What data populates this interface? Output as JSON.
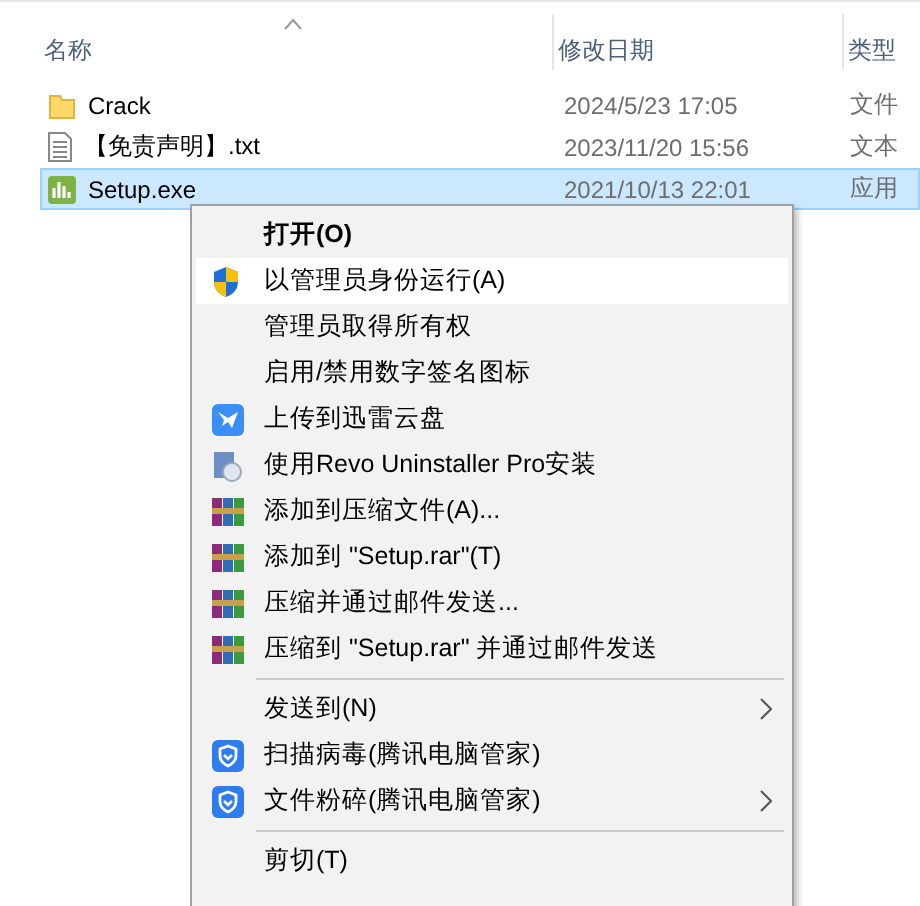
{
  "columns": [
    {
      "label": "名称",
      "sorted": true
    },
    {
      "label": "修改日期",
      "sorted": false
    },
    {
      "label": "类型",
      "sorted": false
    }
  ],
  "files": [
    {
      "name": "Crack",
      "date": "2024/5/23 17:05",
      "type": "文件",
      "kind": "folder",
      "selected": false
    },
    {
      "name": "【免责声明】.txt",
      "date": "2023/11/20 15:56",
      "type": "文本",
      "kind": "text",
      "selected": false
    },
    {
      "name": "Setup.exe",
      "date": "2021/10/13 22:01",
      "type": "应用",
      "kind": "app",
      "selected": true
    }
  ],
  "menu": [
    {
      "kind": "plain",
      "label": "打开(O)",
      "default": true,
      "submenu": false,
      "selected": false
    },
    {
      "kind": "uac",
      "label": "以管理员身份运行(A)",
      "default": false,
      "submenu": false,
      "selected": true
    },
    {
      "kind": "plain",
      "label": "管理员取得所有权",
      "default": false,
      "submenu": false,
      "selected": false
    },
    {
      "kind": "plain",
      "label": "启用/禁用数字签名图标",
      "default": false,
      "submenu": false,
      "selected": false
    },
    {
      "kind": "cloud",
      "label": "上传到迅雷云盘",
      "default": false,
      "submenu": false,
      "selected": false
    },
    {
      "kind": "revo",
      "label": "使用Revo Uninstaller Pro安装",
      "default": false,
      "submenu": false,
      "selected": false
    },
    {
      "kind": "archive",
      "label": "添加到压缩文件(A)...",
      "default": false,
      "submenu": false,
      "selected": false
    },
    {
      "kind": "archive",
      "label": "添加到 \"Setup.rar\"(T)",
      "default": false,
      "submenu": false,
      "selected": false
    },
    {
      "kind": "archive",
      "label": "压缩并通过邮件发送...",
      "default": false,
      "submenu": false,
      "selected": false
    },
    {
      "kind": "archive",
      "label": "压缩到 \"Setup.rar\" 并通过邮件发送",
      "default": false,
      "submenu": false,
      "selected": false
    },
    {
      "kind": "separator"
    },
    {
      "kind": "plain",
      "label": "发送到(N)",
      "default": false,
      "submenu": true,
      "selected": false
    },
    {
      "kind": "guard",
      "label": "扫描病毒(腾讯电脑管家)",
      "default": false,
      "submenu": false,
      "selected": false
    },
    {
      "kind": "guard",
      "label": "文件粉碎(腾讯电脑管家)",
      "default": false,
      "submenu": true,
      "selected": false
    },
    {
      "kind": "separator"
    },
    {
      "kind": "plain",
      "label": "剪切(T)",
      "default": false,
      "submenu": false,
      "selected": false
    }
  ]
}
